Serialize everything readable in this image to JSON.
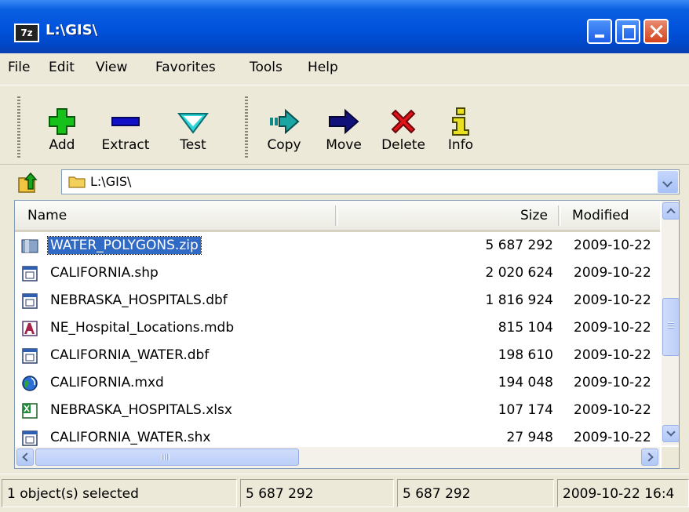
{
  "window": {
    "title": "L:\\GIS\\",
    "app_icon_text": "7z"
  },
  "menu": [
    {
      "label": "File"
    },
    {
      "label": "Edit"
    },
    {
      "label": "View"
    },
    {
      "label": "Favorites"
    },
    {
      "label": "Tools"
    },
    {
      "label": "Help"
    }
  ],
  "toolbar": {
    "add": "Add",
    "extract": "Extract",
    "test": "Test",
    "copy": "Copy",
    "move": "Move",
    "delete": "Delete",
    "info": "Info"
  },
  "address": {
    "path": "L:\\GIS\\"
  },
  "columns": {
    "name": "Name",
    "size": "Size",
    "modified": "Modified"
  },
  "files": [
    {
      "name": "WATER_POLYGONS.zip",
      "size": "5 687 292",
      "modified": "2009-10-22",
      "icon": "zip-archive-icon",
      "selected": true
    },
    {
      "name": "CALIFORNIA.shp",
      "size": "2 020 624",
      "modified": "2009-10-22",
      "icon": "generic-file-icon"
    },
    {
      "name": "NEBRASKA_HOSPITALS.dbf",
      "size": "1 816 924",
      "modified": "2009-10-22",
      "icon": "generic-file-icon"
    },
    {
      "name": "NE_Hospital_Locations.mdb",
      "size": "815 104",
      "modified": "2009-10-22",
      "icon": "access-database-icon"
    },
    {
      "name": "CALIFORNIA_WATER.dbf",
      "size": "198 610",
      "modified": "2009-10-22",
      "icon": "generic-file-icon"
    },
    {
      "name": "CALIFORNIA.mxd",
      "size": "194 048",
      "modified": "2009-10-22",
      "icon": "arcmap-document-icon"
    },
    {
      "name": "NEBRASKA_HOSPITALS.xlsx",
      "size": "107 174",
      "modified": "2009-10-22",
      "icon": "excel-file-icon"
    },
    {
      "name": "CALIFORNIA_WATER.shx",
      "size": "27 948",
      "modified": "2009-10-22",
      "icon": "generic-file-icon"
    }
  ],
  "status": {
    "selection": "1 object(s) selected",
    "size": "5 687 292",
    "packed": "5 687 292",
    "modified": "2009-10-22 16:4"
  },
  "colors": {
    "titlebar": "#0052dc",
    "selection": "#316ac5",
    "close_button": "#d5431e"
  }
}
